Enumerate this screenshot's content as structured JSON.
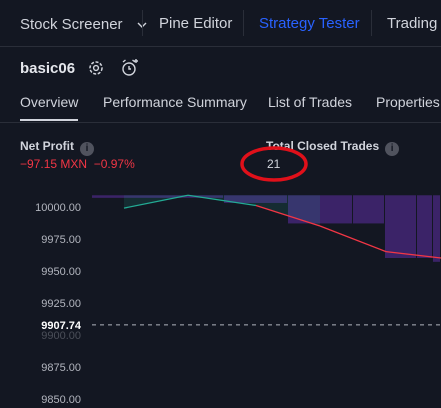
{
  "toolbar": {
    "stock_screener": "Stock Screener",
    "pine_editor": "Pine Editor",
    "strategy_tester": "Strategy Tester",
    "trading_panel": "Trading P"
  },
  "strategy": {
    "name": "basic06"
  },
  "tabs": [
    "Overview",
    "Performance Summary",
    "List of Trades",
    "Properties"
  ],
  "metrics": {
    "net_profit": {
      "label": "Net Profit",
      "value": "−97.15 MXN",
      "percent": "−0.97%"
    },
    "total_closed_trades": {
      "label": "Total Closed Trades",
      "value": "21"
    }
  },
  "annotation": {
    "color": "#e0101a"
  },
  "chart_data": {
    "type": "line",
    "y_ticks": [
      "10000.00",
      "9975.00",
      "9950.00",
      "9925.00",
      "9907.74",
      "9900.00",
      "9875.00",
      "9850.00"
    ],
    "ylim": [
      9850,
      10010
    ],
    "current_value": 9907.74,
    "series": [
      {
        "values": [
          9999,
          10009,
          10001,
          9985,
          9965,
          9960
        ],
        "colors": [
          "#22ab94",
          "#f23645"
        ]
      }
    ],
    "drawdown_bars": [
      {
        "top": 10009,
        "bottom": 10007
      },
      {
        "top": 10009,
        "bottom": 10003
      },
      {
        "top": 10009,
        "bottom": 9987
      },
      {
        "top": 10009,
        "bottom": 9987
      },
      {
        "top": 10009,
        "bottom": 9960
      },
      {
        "top": 10009,
        "bottom": 9960
      },
      {
        "top": 10009,
        "bottom": 9957
      }
    ],
    "grid": false
  }
}
